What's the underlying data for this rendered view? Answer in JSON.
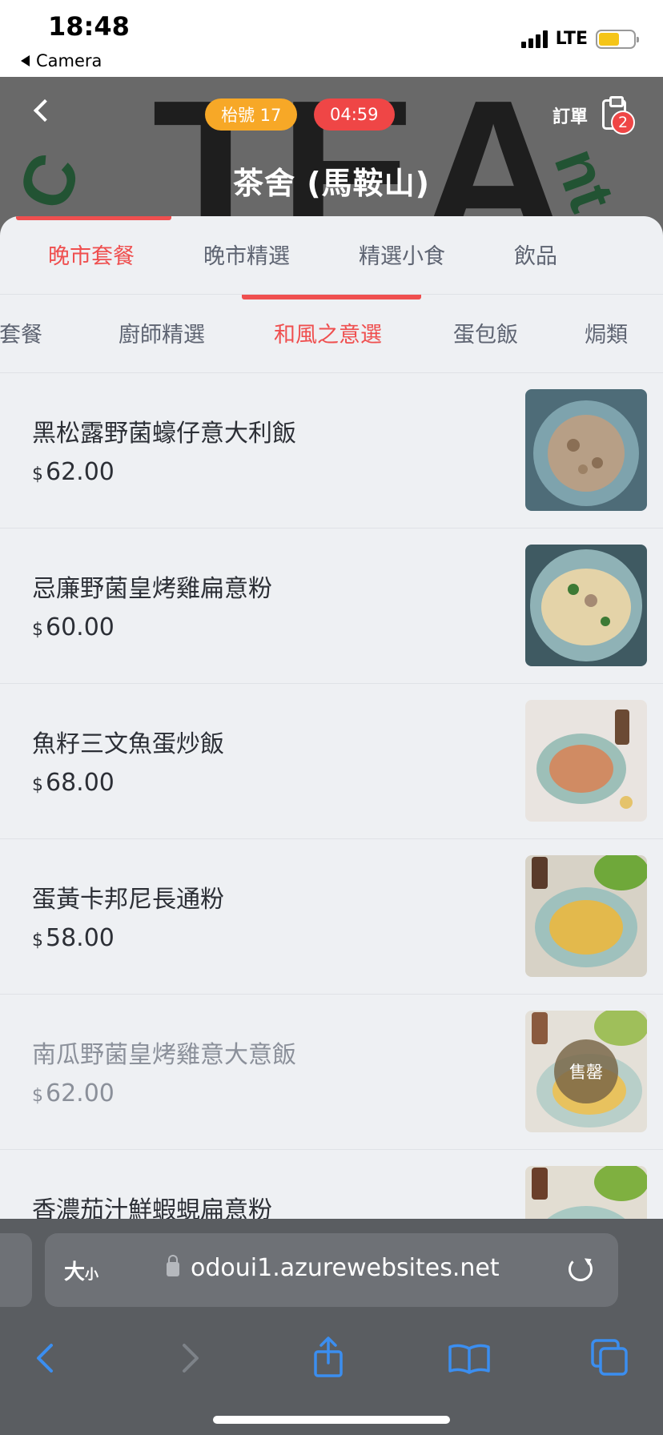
{
  "status_bar": {
    "time": "18:48",
    "back_app": "Camera",
    "network": "LTE",
    "battery_level": 0.6
  },
  "header": {
    "ticket": "枱號 17",
    "timer": "04:59",
    "order_label": "訂單",
    "order_count": "2",
    "store_name": "茶舍 (馬鞍山)",
    "icons": {
      "back": "chevron-left-icon",
      "order": "clipboard-icon"
    }
  },
  "category_tabs": [
    {
      "label": "晚市套餐",
      "active": true
    },
    {
      "label": "晚市精選",
      "active": false
    },
    {
      "label": "精選小食",
      "active": false
    },
    {
      "label": "飲品",
      "active": false
    }
  ],
  "sub_tabs": [
    {
      "label": "人套餐",
      "active": false
    },
    {
      "label": "廚師精選",
      "active": false
    },
    {
      "label": "和風之意選",
      "active": true
    },
    {
      "label": "蛋包飯",
      "active": false
    },
    {
      "label": "焗類",
      "active": false
    }
  ],
  "menu_items": [
    {
      "name": "黑松露野菌蠔仔意大利飯",
      "currency": "$",
      "price": "62.00",
      "sold_out": false
    },
    {
      "name": "忌廉野菌皇烤雞扁意粉",
      "currency": "$",
      "price": "60.00",
      "sold_out": false
    },
    {
      "name": "魚籽三文魚蛋炒飯",
      "currency": "$",
      "price": "68.00",
      "sold_out": false
    },
    {
      "name": "蛋黃卡邦尼長通粉",
      "currency": "$",
      "price": "58.00",
      "sold_out": false
    },
    {
      "name": "南瓜野菌皇烤雞意大意飯",
      "currency": "$",
      "price": "62.00",
      "sold_out": true,
      "sold_out_label": "售罄"
    },
    {
      "name": "香濃茄汁鮮蝦蜆扁意粉",
      "currency": "$",
      "price": "",
      "sold_out": false
    }
  ],
  "browser": {
    "text_size_label": "大",
    "text_size_small": "小",
    "url": "odoui1.azurewebsites.net",
    "icons": [
      "back-icon",
      "forward-icon",
      "share-icon",
      "bookmarks-icon",
      "tabs-icon"
    ]
  },
  "colors": {
    "accent": "#ef4f4f",
    "ticket_pill": "#f7a827",
    "timer_pill": "#ef4646",
    "safari_blue": "#3b8ef0"
  }
}
